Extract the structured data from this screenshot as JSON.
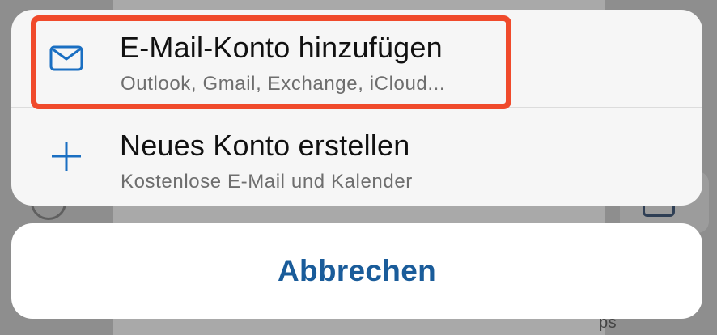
{
  "options": [
    {
      "icon": "mail-icon",
      "title": "E-Mail-Konto hinzufügen",
      "subtitle": "Outlook, Gmail, Exchange, iCloud..."
    },
    {
      "icon": "plus-icon",
      "title": "Neues Konto erstellen",
      "subtitle": "Kostenlose E-Mail und Kalender"
    }
  ],
  "cancel_label": "Abbrechen",
  "background": {
    "partial_text": "ps"
  },
  "colors": {
    "accent": "#1a5c9a",
    "highlight": "#f04a2b",
    "sheet": "#f6f6f6"
  }
}
